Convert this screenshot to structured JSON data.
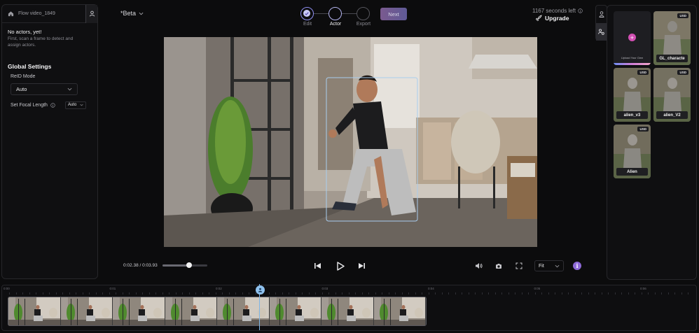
{
  "project": {
    "name": "Flow video_1849",
    "beta_label": "*Beta"
  },
  "left_panel": {
    "no_actors_title": "No actors, yet!",
    "no_actors_desc": "First, scan a frame to detect and assign actors.",
    "global_settings_title": "Global Settings",
    "reid_label": "ReID Mode",
    "reid_value": "Auto",
    "focal_label": "Set Focal Length",
    "focal_value": "Auto"
  },
  "stepper": {
    "steps": [
      {
        "label": "Edit",
        "state": "done"
      },
      {
        "label": "Actor",
        "state": "active"
      },
      {
        "label": "Export",
        "state": "pending"
      }
    ],
    "next_label": "Next"
  },
  "account": {
    "seconds_left": "1167 seconds left",
    "upgrade_label": "Upgrade"
  },
  "player": {
    "time": "0:02.38 / 0:03.93",
    "progress": 0.6,
    "fit_value": "Fit"
  },
  "actors_library": {
    "upload_label": "Upload Your Own",
    "items": [
      {
        "name": "GL_characte",
        "badge": "USD"
      },
      {
        "name": "alien_v3",
        "badge": "USD"
      },
      {
        "name": "alien_V2",
        "badge": "USD"
      },
      {
        "name": "Alien",
        "badge": "USD"
      }
    ]
  },
  "timeline": {
    "tick_labels": [
      "0:00",
      "0:01",
      "0:02",
      "0:03",
      "0:04",
      "0:05",
      "0:06"
    ],
    "frame_count": 8
  },
  "colors": {
    "accent": "#8e6ad8",
    "playhead": "#8fc2ef",
    "next_button": "#6a5a92"
  },
  "icons": [
    "home-icon",
    "user-icon",
    "chevron-down-icon",
    "check-icon",
    "info-icon",
    "rocket-icon",
    "skip-back-icon",
    "play-icon",
    "skip-forward-icon",
    "volume-icon",
    "camera-icon",
    "fullscreen-icon",
    "actor-icon",
    "settings-user-icon",
    "plus-icon"
  ]
}
